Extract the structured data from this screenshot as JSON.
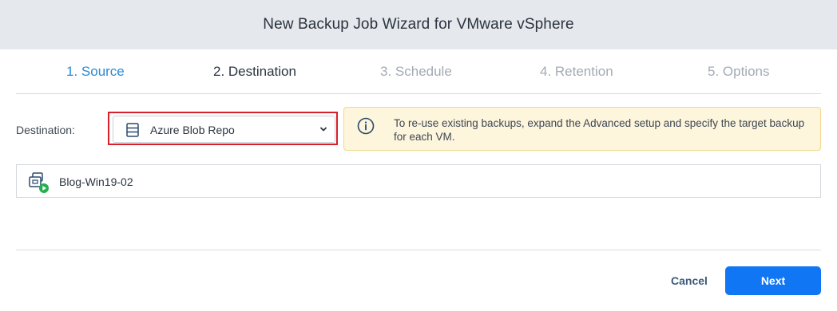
{
  "window": {
    "title": "New Backup Job Wizard for VMware vSphere"
  },
  "steps": [
    {
      "label": "1. Source",
      "state": "done"
    },
    {
      "label": "2. Destination",
      "state": "current"
    },
    {
      "label": "3. Schedule",
      "state": "future"
    },
    {
      "label": "4. Retention",
      "state": "future"
    },
    {
      "label": "5. Options",
      "state": "future"
    }
  ],
  "destination": {
    "label": "Destination:",
    "selected": "Azure Blob Repo",
    "icon": "repository-icon"
  },
  "info": {
    "icon": "info-icon",
    "text": "To re-use existing backups, expand the Advanced setup and specify the target backup for each VM."
  },
  "vms": [
    {
      "name": "Blog-Win19-02",
      "icon": "vm-running-icon"
    }
  ],
  "footer": {
    "cancel_label": "Cancel",
    "next_label": "Next"
  },
  "colors": {
    "accent": "#1176f3",
    "done_step": "#2a8ad3",
    "future_step": "#a3aab3",
    "highlight": "#d7202b",
    "info_bg": "#fdf5dc",
    "running_badge": "#22b04b"
  }
}
